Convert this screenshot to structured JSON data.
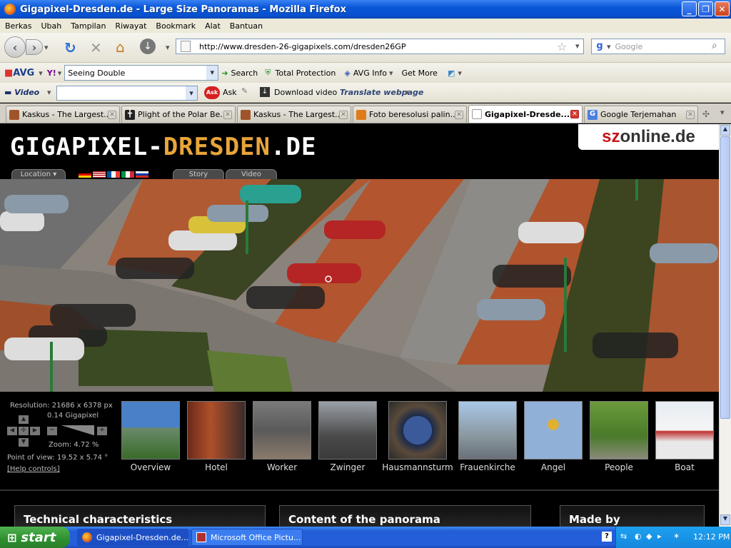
{
  "window": {
    "title": "Gigapixel-Dresden.de - Large Size Panoramas - Mozilla Firefox"
  },
  "menu": [
    "Berkas",
    "Ubah",
    "Tampilan",
    "Riwayat",
    "Bookmark",
    "Alat",
    "Bantuan"
  ],
  "nav": {
    "url": "http://www.dresden-26-gigapixels.com/dresden26GP",
    "search_placeholder": "Google"
  },
  "avg": {
    "brand": "AVG",
    "yahoo_query": "Seeing Double",
    "search": "Search",
    "total_protection": "Total Protection",
    "avg_info": "AVG Info",
    "get_more": "Get More"
  },
  "videobar": {
    "video": "Video",
    "ask": "Ask",
    "download": "Download video",
    "translate": "Translate webpage"
  },
  "tabs": [
    {
      "label": "Kaskus - The Largest...",
      "icon": "kaskus-icon"
    },
    {
      "label": "Plight of the Polar Be...",
      "icon": "polar-icon"
    },
    {
      "label": "Kaskus - The Largest...",
      "icon": "kaskus-icon"
    },
    {
      "label": "Foto beresolusi palin...",
      "icon": "foto-icon"
    },
    {
      "label": "Gigapixel-Dresde...",
      "icon": "page-icon"
    },
    {
      "label": "Google Terjemahan",
      "icon": "google-icon"
    }
  ],
  "site": {
    "logo_white": "GIGAPIXEL-",
    "logo_accent": "DRESDEN",
    ".de_suffix": ".DE",
    "partner": "sz",
    "partner_rest": "online.de",
    "location": "Location",
    "story": "Story",
    "video": "Video",
    "resolution": "Resolution: 21686 x 6378 px",
    "gigapixel": "0.14 Gigapixel",
    "zoom": "Zoom: 4.72 %",
    "pov": "Point of view: 19.52 x 5.74 °",
    "help": "[Help controls]",
    "thumbs": [
      "Overview",
      "Hotel",
      "Worker",
      "Zwinger",
      "Hausmannsturm",
      "Frauenkirche",
      "Angel",
      "People",
      "Boat"
    ],
    "sections": [
      "Technical characteristics",
      "Content of the panorama",
      "Made by"
    ]
  },
  "taskbar": {
    "start": "start",
    "tasks": [
      "Gigapixel-Dresden.de...",
      "Microsoft Office Pictu..."
    ],
    "time": "12:12 PM"
  }
}
